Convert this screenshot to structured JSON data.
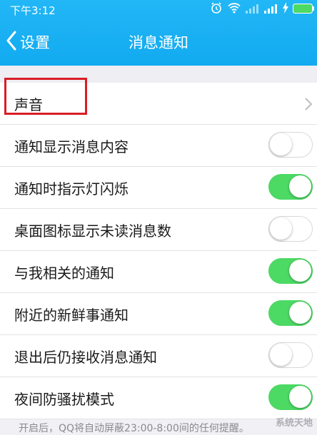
{
  "status_bar": {
    "time": "下午3:12",
    "icons": [
      "alarm-icon",
      "wifi-icon",
      "signal-icon",
      "signal-icon",
      "charging-icon",
      "battery-icon"
    ]
  },
  "nav": {
    "back_label": "设置",
    "title": "消息通知"
  },
  "settings": [
    {
      "label": "声音",
      "control": "chevron"
    },
    {
      "label": "通知显示消息内容",
      "control": "toggle",
      "on": false
    },
    {
      "label": "通知时指示灯闪烁",
      "control": "toggle",
      "on": true
    },
    {
      "label": "桌面图标显示未读消息数",
      "control": "toggle",
      "on": false
    },
    {
      "label": "与我相关的通知",
      "control": "toggle",
      "on": true
    },
    {
      "label": "附近的新鲜事通知",
      "control": "toggle",
      "on": true
    },
    {
      "label": "退出后仍接收消息通知",
      "control": "toggle",
      "on": false
    },
    {
      "label": "夜间防骚扰模式",
      "control": "toggle",
      "on": true
    }
  ],
  "footer_note": "开启后，QQ将自动屏蔽23:00-8:00间的任何提醒。",
  "watermark": "系统天地",
  "colors": {
    "header_blue": "#12aaf0",
    "toggle_on_green": "#4cd964",
    "highlight_red": "#d81e26"
  }
}
